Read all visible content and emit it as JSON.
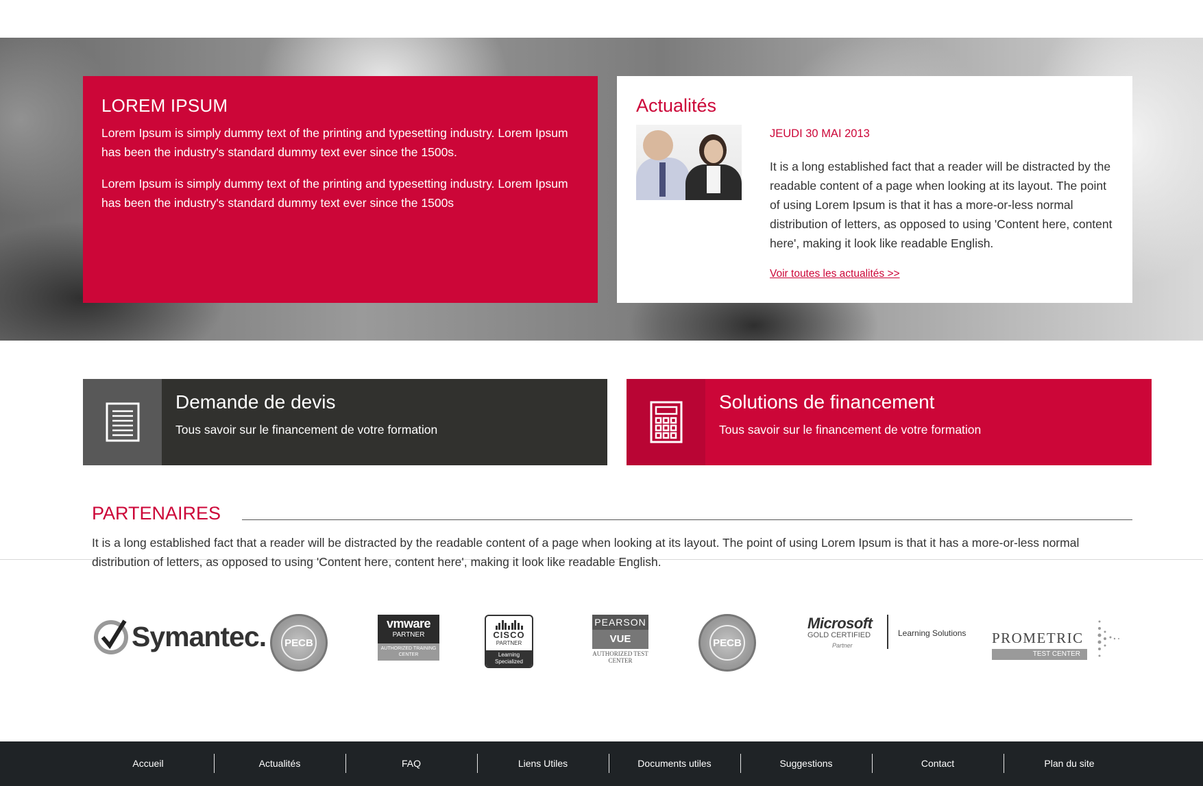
{
  "hero": {
    "lorem": {
      "title": "LOREM IPSUM",
      "paragraphs": [
        "Lorem Ipsum is simply dummy text of the printing and typesetting industry. Lorem Ipsum has been the industry's standard dummy text ever since the 1500s.",
        "Lorem Ipsum is simply dummy text of the printing and typesetting industry. Lorem Ipsum has been the industry's standard dummy text ever since the 1500s"
      ]
    },
    "news": {
      "title": "Actualités",
      "date": "JEUDI 30 MAI 2013",
      "text": "It is a long established fact that a reader will be distracted by the readable content of a page when looking at its layout. The point of using Lorem Ipsum is that it has a more-or-less normal distribution of letters, as opposed to using 'Content here, content here', making it look like readable English.",
      "link": "Voir toutes les actualités >>"
    }
  },
  "cta": {
    "devis": {
      "title": "Demande de devis",
      "subtitle": "Tous savoir sur le financement de votre formation",
      "icon": "document-icon"
    },
    "financement": {
      "title": "Solutions de financement",
      "subtitle": "Tous savoir sur le financement de votre formation",
      "icon": "calculator-icon"
    }
  },
  "partners": {
    "title": "PARTENAIRES",
    "text": "It is a long established fact that a reader will be distracted by the readable content of a page when looking at its layout. The point of using Lorem Ipsum is that it has a more-or-less normal distribution of letters, as opposed to using 'Content here, content here', making it look like readable English.",
    "logos": {
      "symantec": "Symantec.",
      "pecb": "PECB",
      "vmware_brand": "vmware",
      "vmware_partner": "PARTNER",
      "vmware_center": "AUTHORIZED TRAINING CENTER",
      "cisco_brand": "CISCO",
      "cisco_partner": "PARTNER",
      "cisco_spec": "Learning Specialized",
      "pearson_top": "PEARSON",
      "pearson_mid": "VUE",
      "pearson_bot": "AUTHORIZED TEST CENTER",
      "ms_brand": "Microsoft",
      "ms_gold": "GOLD CERTIFIED",
      "ms_partner": "Partner",
      "ms_learning": "Learning Solutions",
      "prometric_name": "PROMETRIC",
      "prometric_center": "TEST CENTER"
    }
  },
  "footer": {
    "links": [
      "Accueil",
      "Actualités",
      "FAQ",
      "Liens Utiles",
      "Documents utiles",
      "Suggestions",
      "Contact",
      "Plan du site"
    ]
  },
  "colors": {
    "accent": "#cc0638",
    "dark": "#31312e",
    "footer": "#1f2326"
  }
}
